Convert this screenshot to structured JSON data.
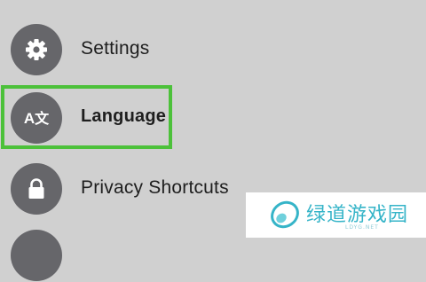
{
  "menu": {
    "items": [
      {
        "label": "Settings",
        "icon": "gear-icon"
      },
      {
        "label": "Language",
        "icon": "language-icon",
        "icon_text_latin": "A",
        "icon_text_cjk": "文",
        "highlighted": true
      },
      {
        "label": "Privacy Shortcuts",
        "icon": "lock-icon"
      }
    ]
  },
  "colors": {
    "background": "#d0d0d0",
    "icon_circle": "#66666a",
    "highlight": "#4cc13a",
    "watermark_text": "#35b4c8"
  },
  "watermark": {
    "text": "绿道游戏园",
    "subtext": "LDYG.NET"
  }
}
